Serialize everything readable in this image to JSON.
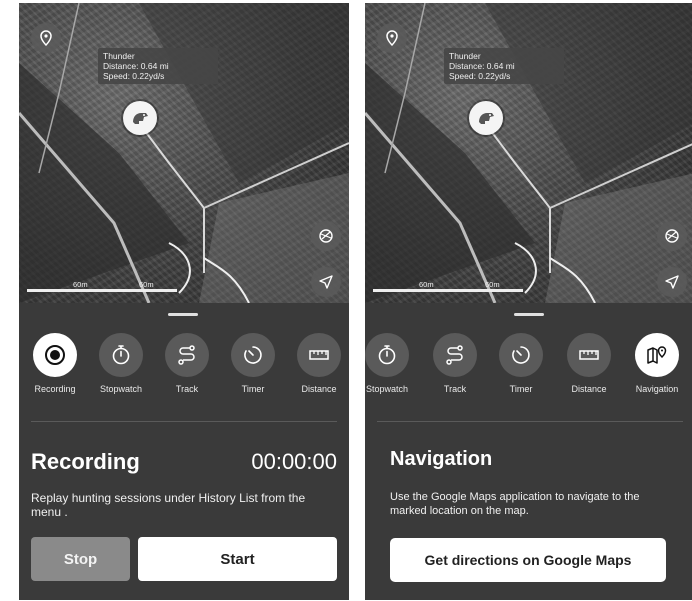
{
  "left": {
    "map": {
      "info_card": {
        "name": "Thunder",
        "distance": "Distance: 0.64 mi",
        "speed": "Speed: 0.22yd/s"
      },
      "scale": {
        "label_a": "60m",
        "label_b": "60m"
      },
      "icons": [
        "location-pin-icon",
        "dog-marker-icon",
        "layers-icon",
        "locate-arrow-icon"
      ]
    },
    "tools": [
      {
        "label": "Recording",
        "icon": "record-icon",
        "active": true
      },
      {
        "label": "Stopwatch",
        "icon": "stopwatch-icon"
      },
      {
        "label": "Track",
        "icon": "track-path-icon"
      },
      {
        "label": "Timer",
        "icon": "timer-icon"
      },
      {
        "label": "Distance",
        "icon": "ruler-icon"
      }
    ],
    "recording": {
      "title": "Recording",
      "time": "00:00:00",
      "description": "Replay hunting sessions under History List from the menu .",
      "stop_label": "Stop",
      "start_label": "Start"
    }
  },
  "right": {
    "map": {
      "info_card": {
        "name": "Thunder",
        "distance": "Distance: 0.64 mi",
        "speed": "Speed: 0.22yd/s"
      },
      "scale": {
        "label_a": "60m",
        "label_b": "60m"
      }
    },
    "tools": [
      {
        "label": "Stopwatch",
        "icon": "stopwatch-icon"
      },
      {
        "label": "Track",
        "icon": "track-path-icon"
      },
      {
        "label": "Timer",
        "icon": "timer-icon"
      },
      {
        "label": "Distance",
        "icon": "ruler-icon"
      },
      {
        "label": "Navigation",
        "icon": "map-navigation-icon",
        "active": true
      }
    ],
    "navigation": {
      "title": "Navigation",
      "description": "Use the Google Maps application to navigate to the marked location on the map.",
      "button_label": "Get directions on Google Maps"
    }
  },
  "colors": {
    "panel": "#3a3a3a",
    "tool_circle": "#5a5a5a",
    "active": "#ffffff",
    "stop_button": "#8a8a8a"
  }
}
